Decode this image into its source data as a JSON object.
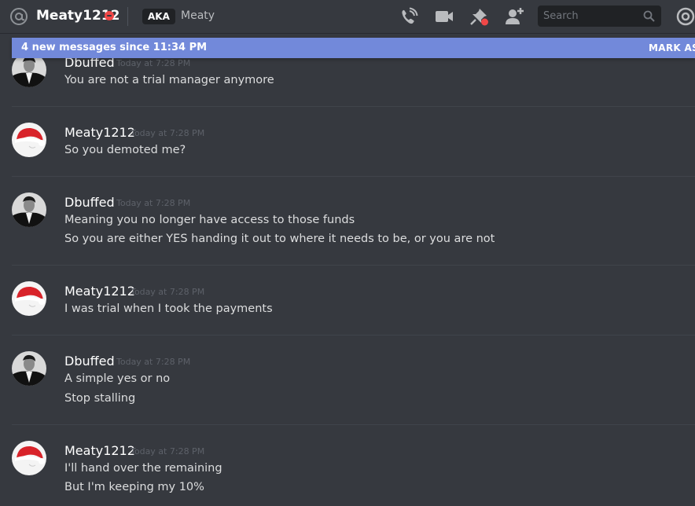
{
  "header": {
    "channel_name": "Meaty1212",
    "aka_label": "AKA",
    "aka_name": "Meaty",
    "search_placeholder": "Search"
  },
  "banner": {
    "text": "4 new messages since 11:34 PM",
    "mark_as_read": "MARK AS R"
  },
  "messages": [
    {
      "author": "Dbuffed",
      "timestamp": "Today at 7:28 PM",
      "lines": [
        "You are not a trial manager anymore"
      ]
    },
    {
      "author": "Meaty1212",
      "timestamp": "Today at 7:28 PM",
      "lines": [
        "So you demoted me?"
      ]
    },
    {
      "author": "Dbuffed",
      "timestamp": "Today at 7:28 PM",
      "lines": [
        "Meaning you no longer have access to those funds",
        "So you are either YES handing it out to where it needs to be, or you are not"
      ]
    },
    {
      "author": "Meaty1212",
      "timestamp": "Today at 7:28 PM",
      "lines": [
        "I was trial when I took the payments"
      ]
    },
    {
      "author": "Dbuffed",
      "timestamp": "Today at 7:28 PM",
      "lines": [
        "A simple yes or no",
        "Stop stalling"
      ]
    },
    {
      "author": "Meaty1212",
      "timestamp": "Today at 7:28 PM",
      "lines": [
        "I'll hand over the remaining",
        "But I'm keeping my 10%"
      ]
    }
  ],
  "colors": {
    "background": "#36393f",
    "banner": "#7289da",
    "dnd_status": "#f04747",
    "username": "#ffffff",
    "text": "#dcddde",
    "timestamp": "#5d6169"
  },
  "icons": {
    "header_left": "at-sign-icon",
    "status": "dnd-status-icon",
    "call": "phone-call-icon",
    "video": "video-camera-icon",
    "pins": "pin-icon",
    "add_friend": "add-user-icon",
    "search": "search-icon",
    "mentions": "at-sign-icon"
  }
}
